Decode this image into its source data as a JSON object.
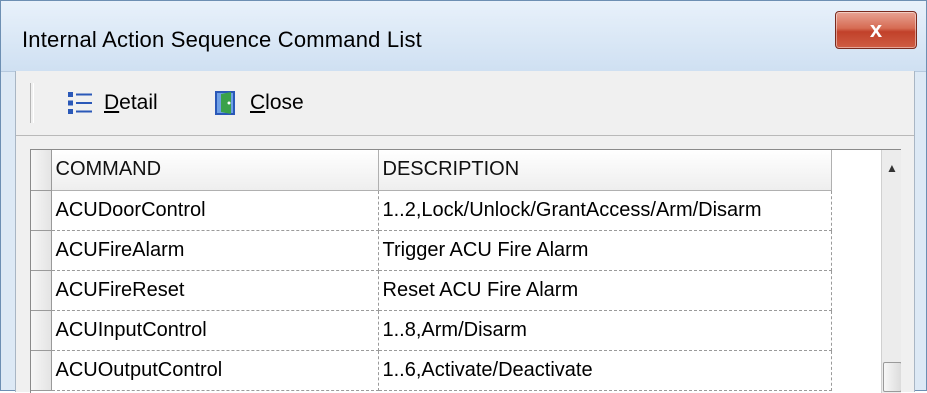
{
  "window": {
    "title": "Internal Action Sequence Command List",
    "close_glyph": "x"
  },
  "toolbar": {
    "detail_label": "Detail",
    "close_label": "Close",
    "detail_icon": "list-icon",
    "close_icon": "door-exit-icon"
  },
  "grid": {
    "columns": [
      "COMMAND",
      "DESCRIPTION"
    ],
    "rows": [
      {
        "command": "ACUDoorControl",
        "description": "1..2,Lock/Unlock/GrantAccess/Arm/Disarm"
      },
      {
        "command": "ACUFireAlarm",
        "description": "Trigger ACU Fire Alarm"
      },
      {
        "command": "ACUFireReset",
        "description": "Reset ACU Fire Alarm"
      },
      {
        "command": "ACUInputControl",
        "description": "1..8,Arm/Disarm"
      },
      {
        "command": "ACUOutputControl",
        "description": "1..6,Activate/Deactivate"
      }
    ]
  },
  "colors": {
    "title_bar": "#cfe0f2",
    "close_button": "#c1412a",
    "toolbar_bg": "#f0f0f0",
    "icon_blue": "#2a58b8",
    "icon_green": "#3aa14a"
  }
}
